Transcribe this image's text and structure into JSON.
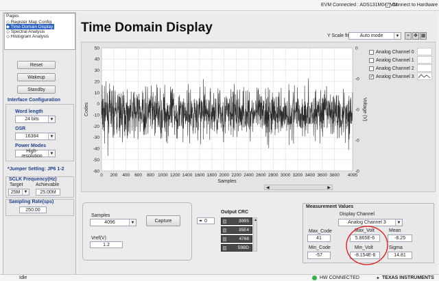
{
  "header": {
    "evm_status": "EVM Connected : ADS131M04EVM",
    "connect_label": "Connect to Hardware"
  },
  "pages": {
    "title": "Pages",
    "items": [
      "Register Map Config",
      "Time Domain Display",
      "Spectral Analysis",
      "Histogram Analysis"
    ],
    "selected_index": 1
  },
  "main_title": "Time Domain Display",
  "controls": {
    "reset": "Reset",
    "wakeup": "Wakeup",
    "standby": "Standby"
  },
  "interface_config": {
    "title": "Interface Configuration",
    "word_length_label": "Word length",
    "word_length_value": "24 bits",
    "osr_label": "OSR",
    "osr_value": "16384",
    "power_modes_label": "Power Modes",
    "power_modes_value": "High-resolution"
  },
  "jumper_setting": "*Jumper Setting: JP6 1-2",
  "sclk": {
    "title": "SCLK Frequency(Hz)",
    "target_label": "Target",
    "target_value": "25M",
    "achievable_label": "Achievable",
    "achievable_value": "25.00M"
  },
  "sampling_rate": {
    "title": "Sampling Rate(sps)",
    "value": "250.00"
  },
  "yscale": {
    "label": "Y Scale fit",
    "value": "Auto mode"
  },
  "channels": [
    {
      "label": "Analog Channel 0",
      "checked": false
    },
    {
      "label": "Analog Channel 1",
      "checked": false
    },
    {
      "label": "Analog Channel 2",
      "checked": false
    },
    {
      "label": "Analog Channel 3",
      "checked": true
    }
  ],
  "chart_data": {
    "type": "line",
    "xlabel": "Samples",
    "ylabel": "Codes",
    "y2label": "Voltage (V)",
    "xlim": [
      0,
      4095
    ],
    "ylim": [
      -60,
      50
    ],
    "x_ticks": [
      "0",
      "200",
      "400",
      "600",
      "800",
      "1000",
      "1200",
      "1400",
      "1600",
      "1800",
      "2000",
      "2200",
      "2400",
      "2600",
      "2800",
      "3000",
      "3200",
      "3400",
      "3600",
      "3800",
      "4095"
    ],
    "y_ticks": [
      "50",
      "40",
      "30",
      "20",
      "10",
      "0",
      "-10",
      "-20",
      "-30",
      "-40",
      "-50",
      "-60"
    ],
    "y2_ticks": [
      "0",
      "-0",
      "-0",
      "-0",
      "-0"
    ],
    "grid": true,
    "series": [
      {
        "name": "Analog Channel 3",
        "mean": -8.25,
        "sigma": 14.81,
        "min": -57,
        "max": 41,
        "color": "#2b2b2b"
      }
    ]
  },
  "capture": {
    "samples_label": "Samples",
    "samples_value": "4096",
    "capture_label": "Capture",
    "vref_label": "Vref(V)",
    "vref_value": "1.2"
  },
  "output_crc": {
    "title": "Output CRC",
    "index_value": "0",
    "values": [
      "39B5",
      "35E4",
      "4768",
      "59BD"
    ]
  },
  "measurements": {
    "title": "Measurement Values",
    "display_channel_label": "Display Channel",
    "display_channel_value": "Analog Channel 3",
    "max_code_label": "Max_Code",
    "max_code_value": "41",
    "max_volt_label": "Max_Volt",
    "max_volt_value": "5.865E-6",
    "mean_label": "Mean",
    "mean_value": "-8.25",
    "min_code_label": "Min_Code",
    "min_code_value": "-57",
    "min_volt_label": "Min_Volt",
    "min_volt_value": "-8.154E-6",
    "sigma_label": "Sigma",
    "sigma_value": "14.81"
  },
  "status": {
    "idle": "Idle",
    "hw": "HW CONNECTED",
    "brand": "TEXAS INSTRUMENTS"
  },
  "colors": {
    "title_blue": "#1f3f8f",
    "annotation_red": "#e02020",
    "hw_led": "#2fb24a"
  }
}
